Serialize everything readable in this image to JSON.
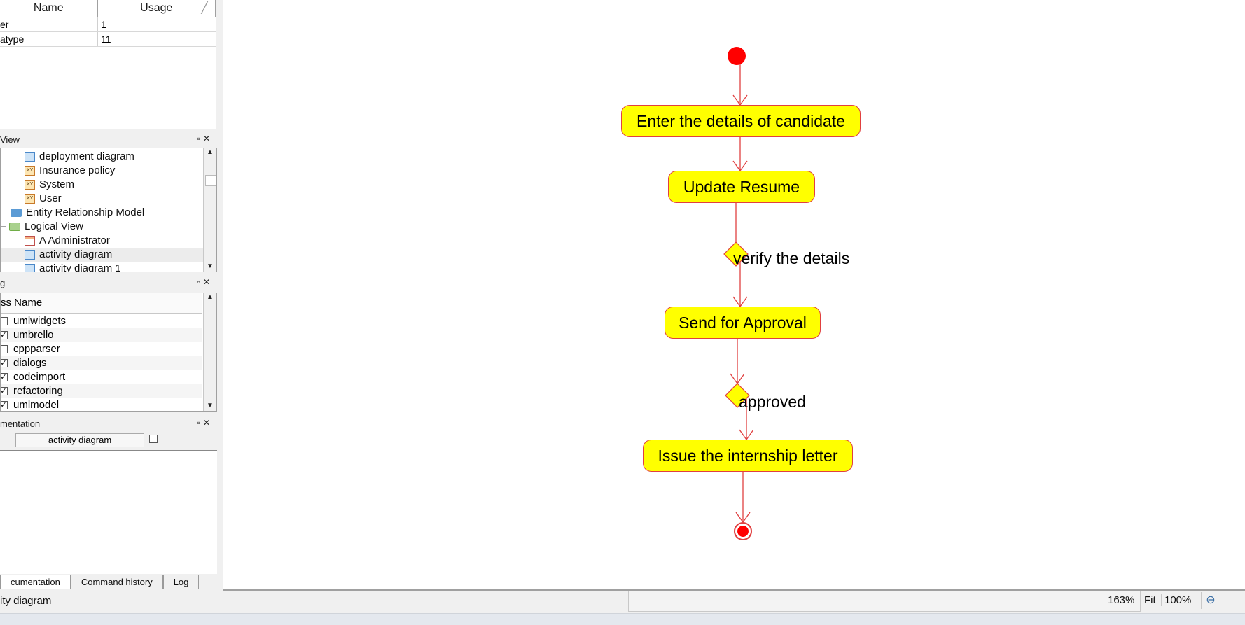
{
  "usage_table": {
    "headers": [
      "Name",
      "Usage"
    ],
    "rows": [
      {
        "name": "er",
        "usage": "1"
      },
      {
        "name": "atype",
        "usage": "11"
      }
    ]
  },
  "tree_view": {
    "title": "View",
    "items": [
      {
        "label": "deployment diagram",
        "icon": "diagram-icon"
      },
      {
        "label": "Insurance policy",
        "icon": "class-icon"
      },
      {
        "label": "System",
        "icon": "class-icon"
      },
      {
        "label": "User",
        "icon": "class-icon"
      },
      {
        "label": "Entity Relationship Model",
        "icon": "folder-icon"
      },
      {
        "label": "Logical View",
        "icon": "folder-icon"
      },
      {
        "label": "A Administrator",
        "icon": "entity-icon"
      },
      {
        "label": "activity diagram",
        "icon": "diagram-icon"
      },
      {
        "label": "activity diagram 1",
        "icon": "diagram-icon"
      }
    ]
  },
  "debug_panel": {
    "title": "g",
    "column": "ss Name",
    "items": [
      {
        "label": "umlwidgets",
        "checked": false
      },
      {
        "label": "umbrello",
        "checked": true
      },
      {
        "label": "cppparser",
        "checked": false
      },
      {
        "label": "dialogs",
        "checked": true
      },
      {
        "label": "codeimport",
        "checked": true
      },
      {
        "label": "refactoring",
        "checked": true
      },
      {
        "label": "umlmodel",
        "checked": true
      }
    ]
  },
  "documentation_panel": {
    "title": "mentation",
    "field_value": "activity diagram"
  },
  "bottom_tabs": [
    "cumentation",
    "Command history",
    "Log"
  ],
  "diagram": {
    "activities": [
      "Enter the details of candidate",
      "Update Resume",
      "Send for Approval",
      "Issue the internship letter"
    ],
    "decision_labels": [
      "verify the details",
      "approved"
    ],
    "colors": {
      "fill": "#ffff00",
      "line": "#e04040",
      "start": "#ff0000"
    }
  },
  "statusbar": {
    "left_text": "ity diagram",
    "zoom_level": "163%",
    "fit_label": "Fit",
    "zoom_100_label": "100%"
  }
}
